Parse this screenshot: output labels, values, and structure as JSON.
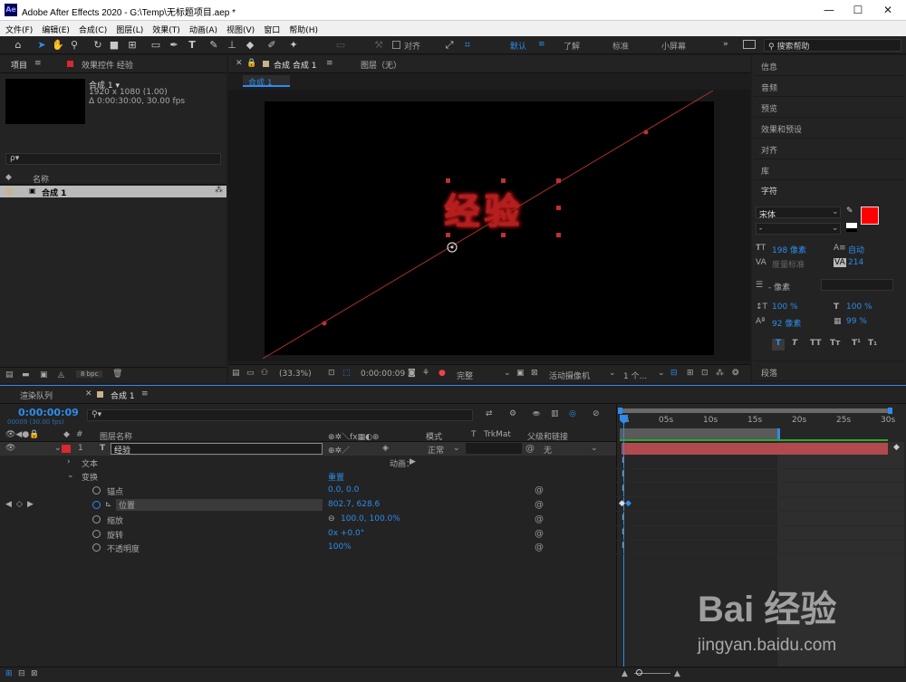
{
  "window": {
    "title": "Adobe After Effects 2020 - G:\\Temp\\无标题项目.aep *",
    "logo": "Ae"
  },
  "menu": [
    "文件(F)",
    "编辑(E)",
    "合成(C)",
    "图层(L)",
    "效果(T)",
    "动画(A)",
    "视图(V)",
    "窗口",
    "帮助(H)"
  ],
  "toolbar": {
    "align_label": "对齐",
    "workspaces": [
      "默认",
      "了解",
      "标准",
      "小屏幕"
    ],
    "active_workspace": "默认",
    "search_placeholder": "搜索帮助"
  },
  "project": {
    "tab": "项目",
    "effects_tab": "效果控件 经验",
    "comp_name": "合成 1 ▾",
    "comp_res": "1920 x 1080 (1.00)",
    "comp_dur": "Δ 0:00:30:00, 30.00 fps",
    "search_placeholder": "ρ▾",
    "col_name": "名称",
    "items": [
      {
        "name": "合成 1"
      }
    ],
    "bpc": "8 bpc"
  },
  "composition": {
    "tab": "合成 合成 1",
    "layer_tab": "图层（无）",
    "breadcrumb": "合成 1",
    "text": "经验",
    "zoom": "(33.3%)",
    "time": "0:00:00:09",
    "quality": "完整",
    "camera": "活动摄像机",
    "views": "1 个..."
  },
  "right_panels": [
    "信息",
    "音频",
    "预览",
    "效果和预设",
    "对齐",
    "库"
  ],
  "character": {
    "title": "字符",
    "font": "宋体",
    "style": "-",
    "size": "198 像素",
    "leading": "自动",
    "kerning": "度量标准",
    "tracking": "214",
    "stroke_px": "- 像素",
    "vscale": "100 %",
    "hscale": "100 %",
    "baseline": "92 像素",
    "tsume": "99 %",
    "fill_color": "#ff0000",
    "paragraph": "段落"
  },
  "timeline": {
    "render_tab": "渲染队列",
    "comp_tab": "合成 1",
    "timecode": "0:00:00:09",
    "frame_info": "00009 (30.00 fps)",
    "cols": {
      "name": "图层名称",
      "mode": "模式",
      "t": "T",
      "trkmat": "TrkMat",
      "parent": "父级和链接"
    },
    "layer": {
      "num": "1",
      "type": "T",
      "name": "经验",
      "mode": "正常",
      "parent": "无"
    },
    "text_group": "文本",
    "animate": "动画：",
    "transform": "变换",
    "reset": "重置",
    "props": [
      {
        "name": "锚点",
        "value": "0.0, 0.0"
      },
      {
        "name": "位置",
        "value": "802.7, 628.6"
      },
      {
        "name": "缩放",
        "value": "100.0, 100.0%"
      },
      {
        "name": "旋转",
        "value": "0x +0.0°"
      },
      {
        "name": "不透明度",
        "value": "100%"
      }
    ],
    "ruler": [
      "0s",
      "05s",
      "10s",
      "15s",
      "20s",
      "25s",
      "30s"
    ]
  },
  "watermark": {
    "brand": "Bai 经验",
    "url": "jingyan.baidu.com"
  }
}
